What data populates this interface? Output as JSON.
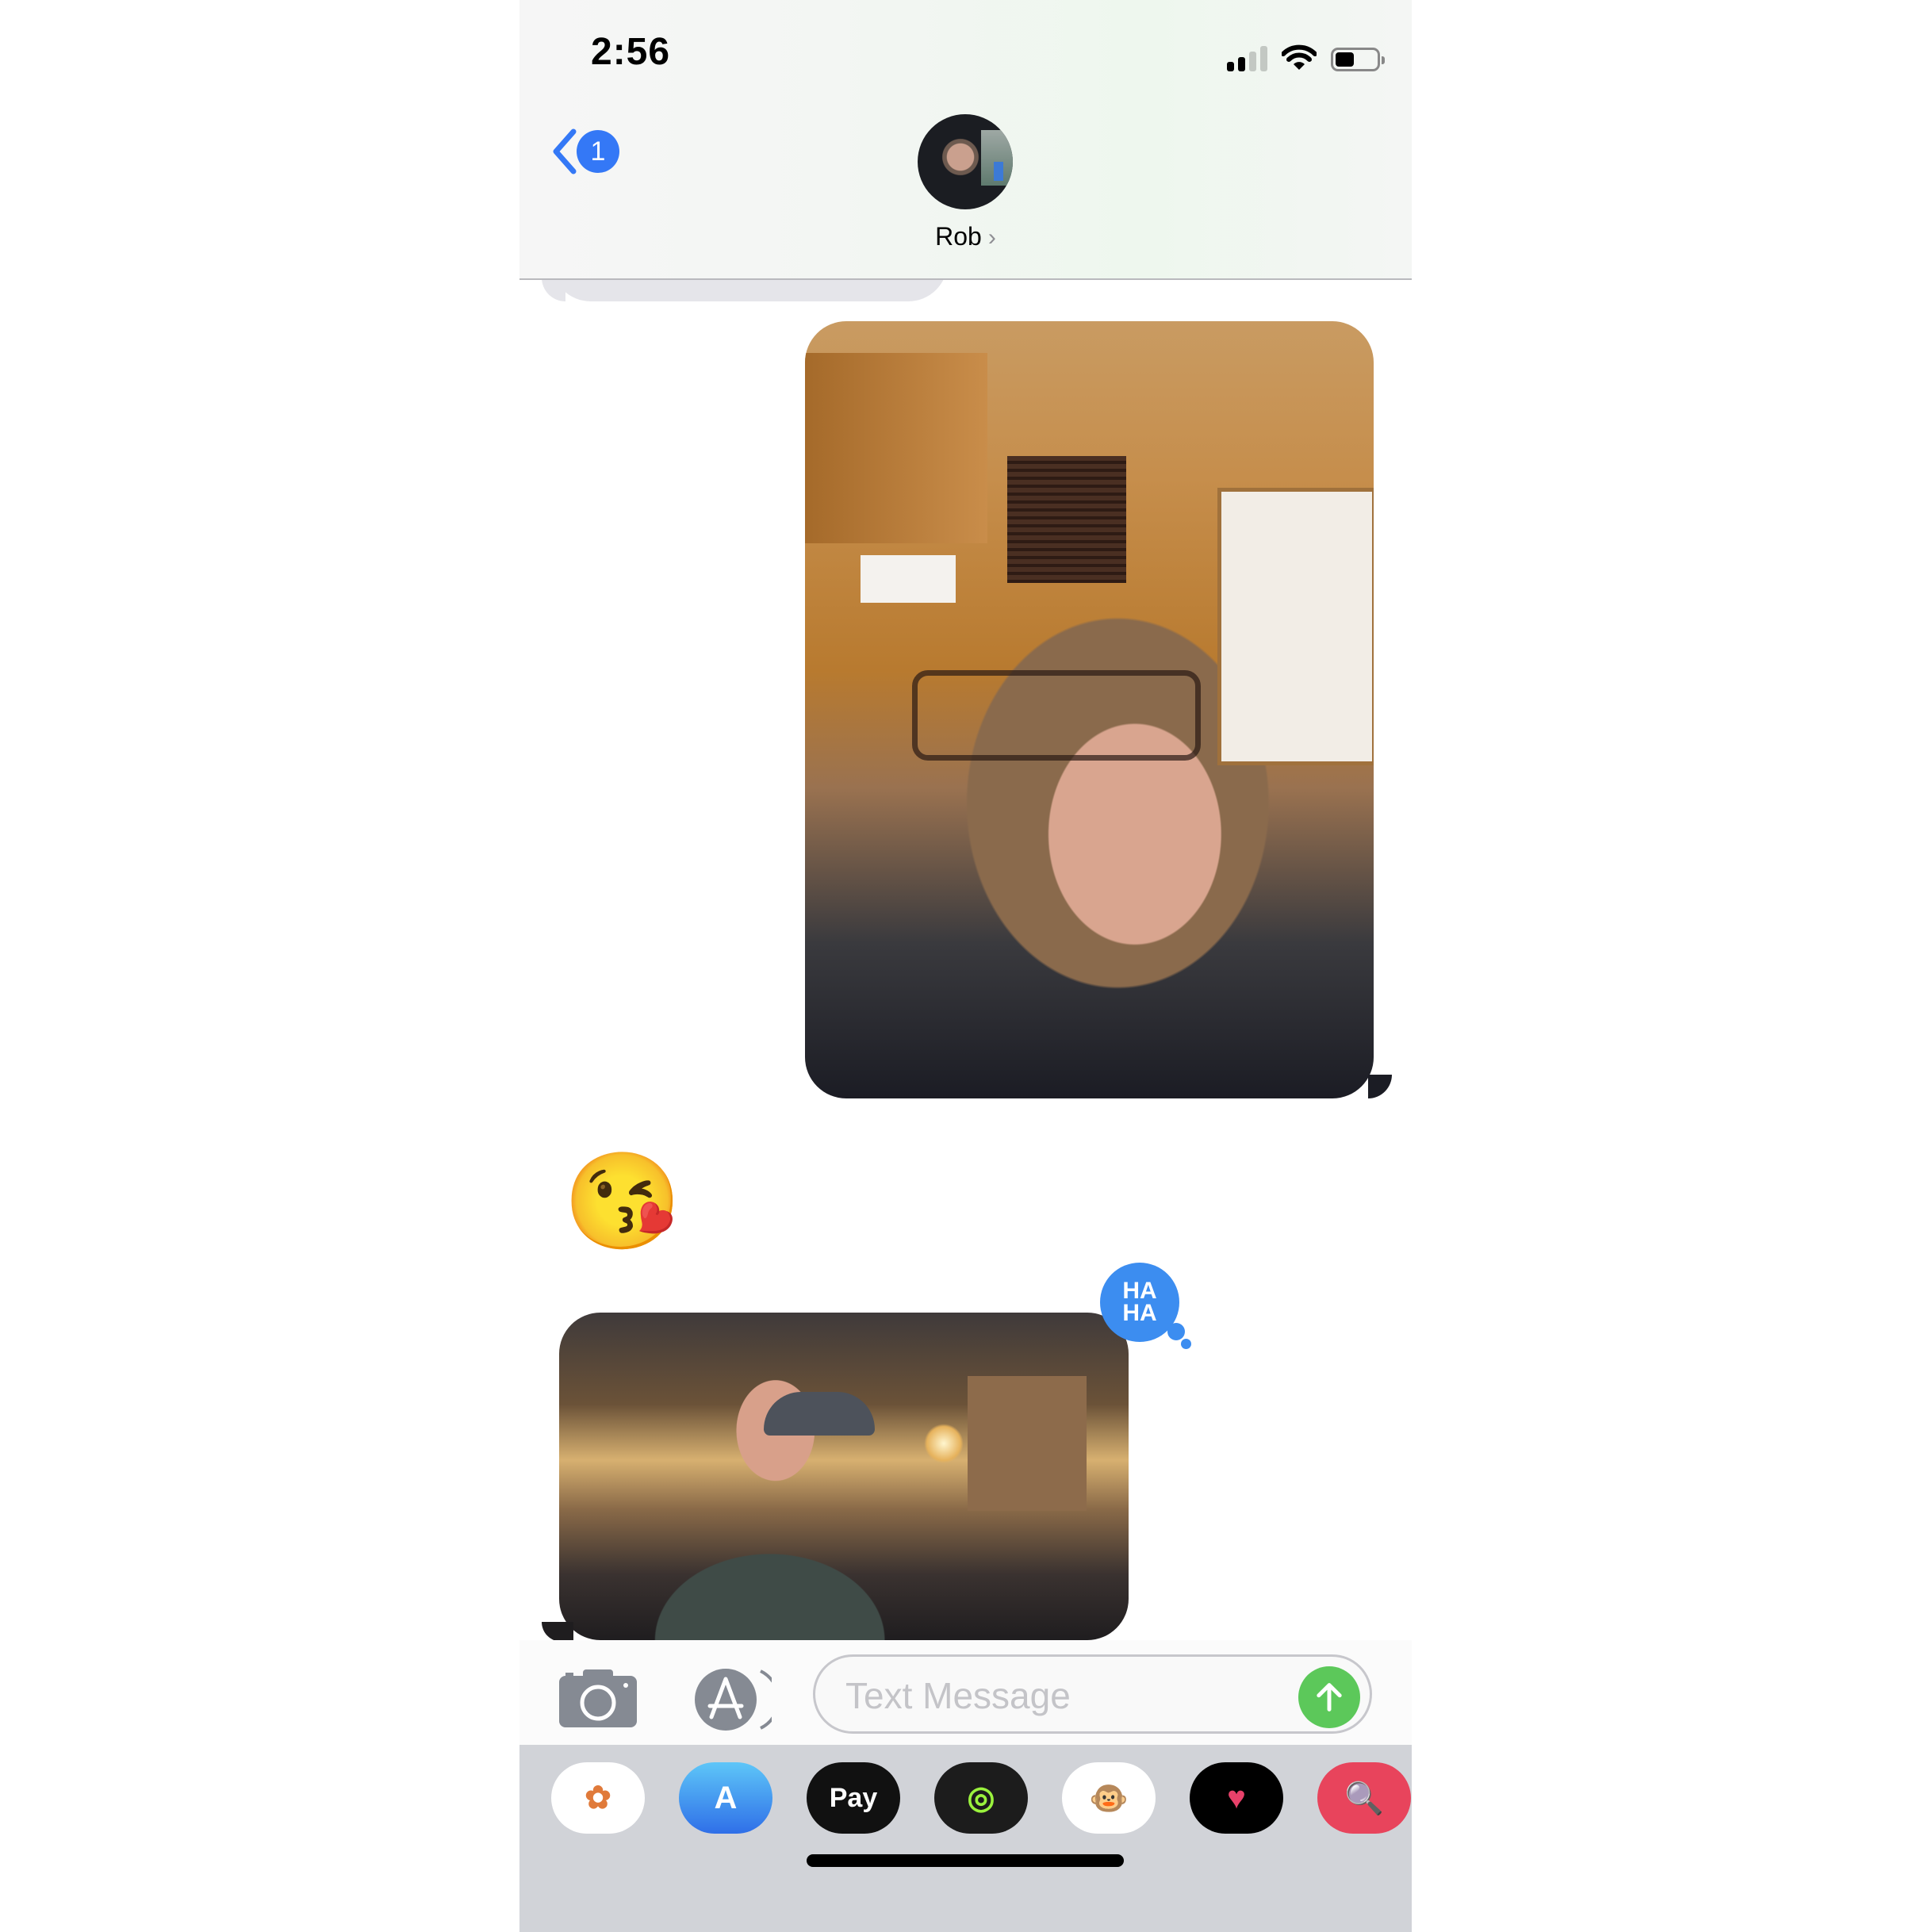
{
  "status_bar": {
    "time": "2:56",
    "signal_bars_active": 2,
    "signal_bars_total": 4,
    "wifi": "wifi-icon",
    "battery_percent": 45
  },
  "nav": {
    "back_badge": "1",
    "contact_name": "Rob",
    "chevron": "›"
  },
  "messages": [
    {
      "type": "incoming-text",
      "text": ""
    },
    {
      "type": "outgoing-photo",
      "description": "selfie of woman with glasses in kitchen"
    },
    {
      "type": "incoming-emoji",
      "emoji": "😘"
    },
    {
      "type": "incoming-photo",
      "description": "man in cap making kissy face in living room",
      "tapback": {
        "label_line1": "HA",
        "label_line2": "HA"
      }
    }
  ],
  "composer": {
    "placeholder": "Text Message",
    "value": ""
  },
  "app_drawer": [
    {
      "name": "photos",
      "label": "✿"
    },
    {
      "name": "app-store",
      "label": "A"
    },
    {
      "name": "apple-pay",
      "label": " Pay"
    },
    {
      "name": "activity",
      "label": "◎"
    },
    {
      "name": "animoji",
      "label": "🐵"
    },
    {
      "name": "digital-touch",
      "label": "♥"
    },
    {
      "name": "images-search",
      "label": "🔍"
    }
  ]
}
